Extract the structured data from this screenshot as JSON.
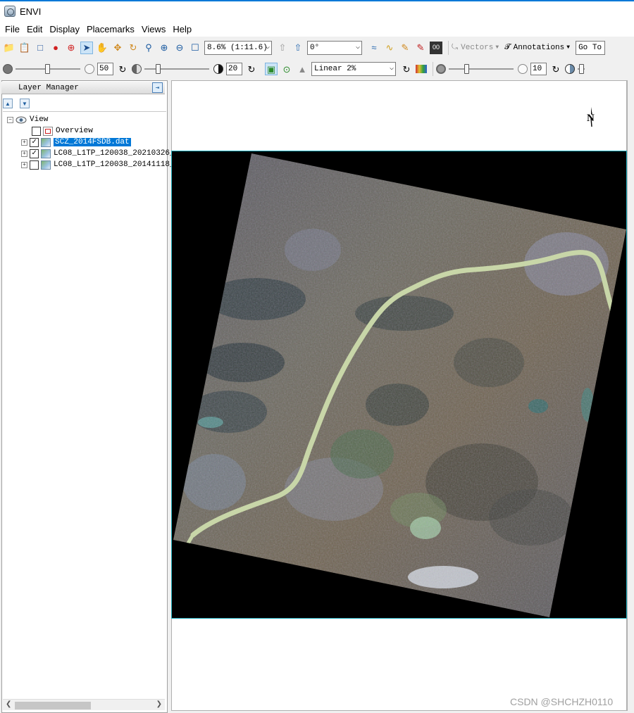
{
  "window": {
    "title": "ENVI"
  },
  "menu": [
    "File",
    "Edit",
    "Display",
    "Placemarks",
    "Views",
    "Help"
  ],
  "toolbar1": {
    "zoom_value": "8.6% (1:11.6)",
    "rotation_value": "0°",
    "vectors_label": "Vectors",
    "annotations_label": "Annotations",
    "goto_label": "Go To"
  },
  "toolbar2": {
    "brightness_value": "50",
    "contrast_value": "20",
    "stretch_value": "Linear 2%",
    "sharpen_value": "10"
  },
  "layer_manager": {
    "title": "Layer Manager",
    "view_label": "View",
    "overview_label": "Overview",
    "layers": [
      {
        "name": "SCZ_2014FSDB.dat",
        "checked": true,
        "selected": true
      },
      {
        "name": "LC08_L1TP_120038_20210326_",
        "checked": true,
        "selected": false
      },
      {
        "name": "LC08_L1TP_120038_20141118_",
        "checked": false,
        "selected": false
      }
    ]
  },
  "display": {
    "north_label": "N"
  },
  "watermark": "CSDN @SHCHZH0110",
  "colors": {
    "selection": "#0078d7",
    "frame_border": "#20b0c0",
    "river": "#c8d6a8"
  }
}
